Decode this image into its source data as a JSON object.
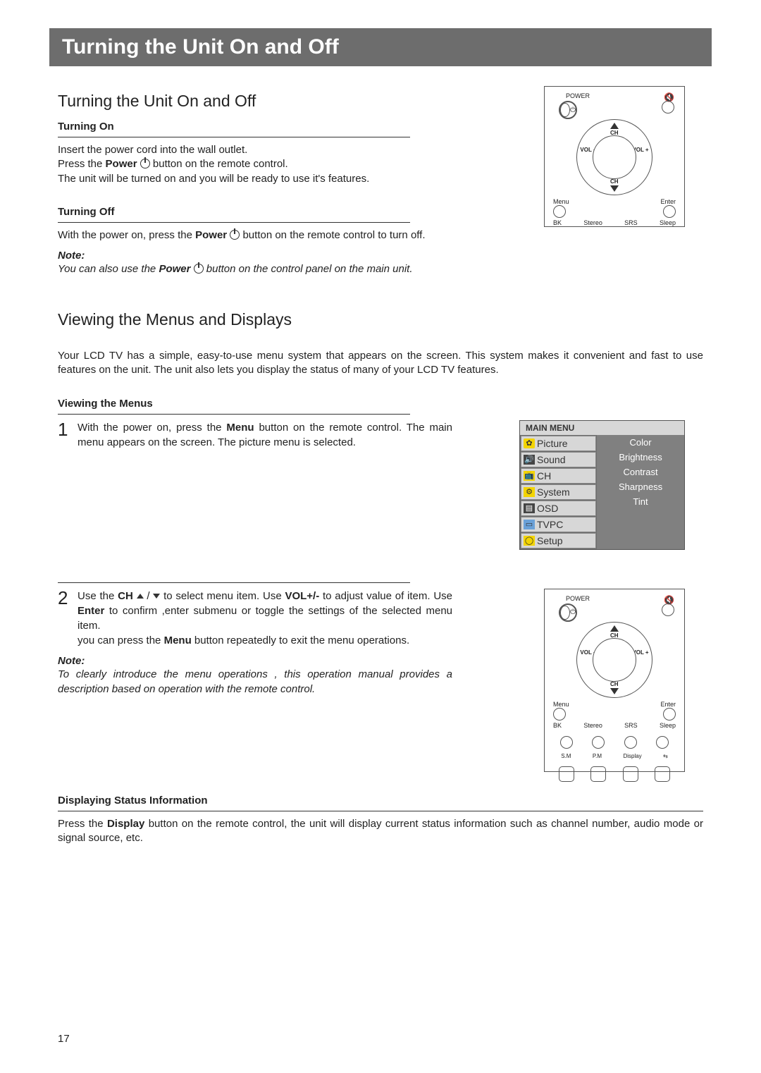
{
  "banner": {
    "title": "Turning the Unit On and Off"
  },
  "s1": {
    "title": "Turning the Unit On and Off",
    "on_hdr": "Turning On",
    "on_l1": "Insert the power cord into the wall outlet.",
    "on_l2a": "Press the ",
    "on_l2b": "Power",
    "on_l2c": " button on the remote control.",
    "on_l3": "The unit will be turned on and you will be ready to use it's features.",
    "off_hdr": "Turning Off",
    "off_l1a": "With the power on, press the ",
    "off_l1b": "Power",
    "off_l1c": " button on the remote control to turn off.",
    "note_hdr": "Note:",
    "note_a": "You can also use the ",
    "note_b": "Power",
    "note_c": " button on the control panel on the main unit."
  },
  "s2": {
    "title": "Viewing the Menus and Displays",
    "intro": "Your LCD TV has a simple, easy-to-use menu system that appears on the screen. This system makes it convenient and fast to use features on the unit. The unit also lets you display the status of many of your LCD TV features.",
    "view_hdr": "Viewing the Menus",
    "step1a": "With the power on, press the ",
    "step1b": "Menu",
    "step1c": " button on the remote control. The main menu appears on the screen. The picture menu is selected.",
    "step2a": "Use the ",
    "step2b": "CH",
    "step2c": " to select menu item. Use ",
    "step2d": "VOL+/-",
    "step2e": " to adjust value  of item. Use ",
    "step2f": "Enter",
    "step2g": " to confirm ,enter submenu or toggle the settings of the selected menu item.",
    "step2h": "you can press the ",
    "step2i": "Menu",
    "step2j": " button repeatedly to exit the menu operations.",
    "note_hdr": "Note:",
    "note_body": "To clearly introduce the menu operations , this operation manual provides a description based on operation with the remote control.",
    "disp_hdr": "Displaying Status Information",
    "disp_a": "Press the ",
    "disp_b": "Display",
    "disp_c": " button on the remote control, the unit will display current status information such as channel number, audio mode or signal source, etc."
  },
  "remote": {
    "power": "POWER",
    "ch": "CH",
    "vol_minus": "VOL\n−",
    "vol_plus": "VOL\n+",
    "menu": "Menu",
    "enter": "Enter",
    "bk": "BK",
    "stereo": "Stereo",
    "srs": "SRS",
    "sleep": "Sleep",
    "sm": "S.M",
    "pm": "P.M",
    "display": "Display"
  },
  "osd": {
    "hdr": "MAIN MENU",
    "left": [
      "Picture",
      "Sound",
      "CH",
      "System",
      "OSD",
      "TVPC",
      "Setup"
    ],
    "right": [
      "Color",
      "Brightness",
      "Contrast",
      "Sharpness",
      "Tint"
    ]
  },
  "page_number": "17"
}
